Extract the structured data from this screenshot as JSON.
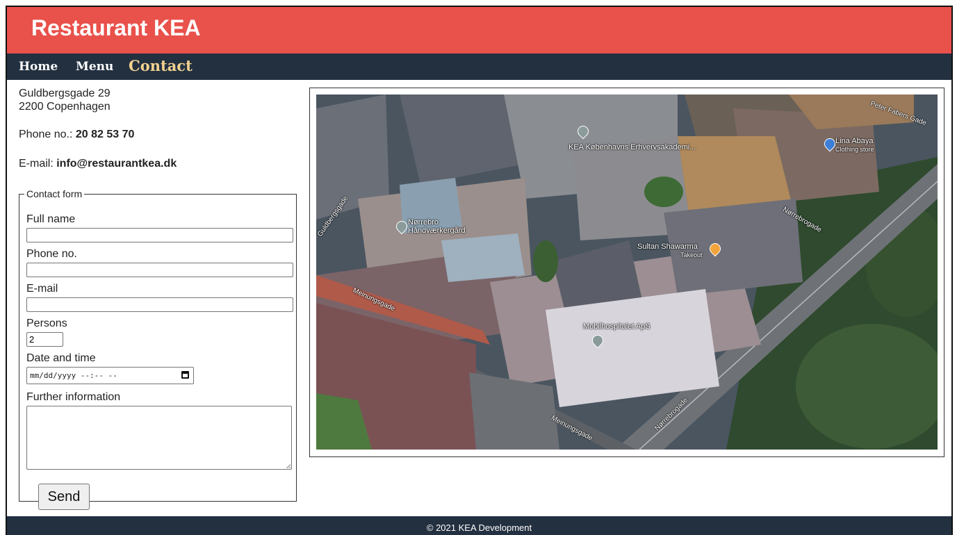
{
  "site": {
    "title": "Restaurant KEA"
  },
  "nav": {
    "items": [
      {
        "label": "Home"
      },
      {
        "label": "Menu"
      },
      {
        "label": "Contact"
      }
    ]
  },
  "contact": {
    "address_line1": "Guldbergsgade 29",
    "address_line2": "2200 Copenhagen",
    "phone_label": "Phone no.:",
    "phone_value": "20 82 53 70",
    "email_label": "E-mail:",
    "email_value": "info@restaurantkea.dk"
  },
  "form": {
    "legend": "Contact form",
    "full_name_label": "Full name",
    "phone_label": "Phone no.",
    "email_label": "E-mail",
    "persons_label": "Persons",
    "persons_value": "2",
    "datetime_label": "Date and time",
    "datetime_placeholder": "mm/dd/yyyy --:-- --",
    "further_info_label": "Further information",
    "send_label": "Send"
  },
  "map": {
    "places": [
      {
        "name": "KEA Københavns Erhvervsakademi..."
      },
      {
        "name": "Lina Abaya",
        "sub": "Clothing store"
      },
      {
        "name": "Nørrebro Håndværkergård"
      },
      {
        "name": "Sultan Shawarma",
        "sub": "Takeout"
      },
      {
        "name": "Mobilhospitalet ApS"
      }
    ],
    "streets": [
      {
        "name": "Peter Fabers Gade"
      },
      {
        "name": "Nørrebrogade"
      },
      {
        "name": "Meinungsgade"
      },
      {
        "name": "Meinungsgade"
      },
      {
        "name": "Nørrebrogade"
      },
      {
        "name": "Guldbergsgade"
      }
    ]
  },
  "footer": {
    "text": "© 2021 KEA Development"
  },
  "colors": {
    "header_bg": "#e9514b",
    "nav_bg": "#233040",
    "nav_active": "#f1d28f",
    "footer_bg": "#233040"
  }
}
